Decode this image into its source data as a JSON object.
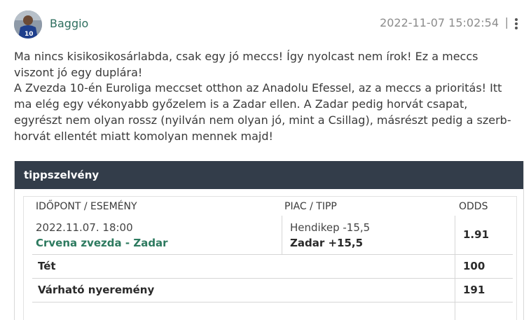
{
  "post": {
    "username": "Baggio",
    "timestamp": "2022-11-07 15:02:54",
    "separator": "|",
    "paragraphs": [
      "Ma nincs kisikosikosárlabda, csak egy jó meccs! Így nyolcast nem írok! Ez a meccs viszont jó egy duplára!",
      "A Zvezda 10-én Euroliga meccset otthon az Anadolu Efessel, az a meccs a prioritás! Itt ma elég egy vékonyabb győzelem is a Zadar ellen. A Zadar pedig horvát csapat, egyrészt nem olyan rossz (nyilván nem olyan jó, mint a Csillag), másrészt pedig a szerb-horvát ellentét miatt komolyan mennek majd!"
    ]
  },
  "ticket": {
    "title": "tippszelvény",
    "headers": {
      "event": "IDŐPONT / ESEMÉNY",
      "market": "PIAC / TIPP",
      "odds": "ODDS"
    },
    "row": {
      "datetime": "2022.11.07. 18:00",
      "match": "Crvena zvezda - Zadar",
      "market": "Hendikep -15,5",
      "tip": "Zadar +15,5",
      "odds": "1.91"
    },
    "stake_label": "Tét",
    "stake_value": "100",
    "payout_label": "Várható nyeremény",
    "payout_value": "191"
  },
  "icons": {
    "menu": "more-vertical-icon",
    "avatar": "user-avatar"
  }
}
